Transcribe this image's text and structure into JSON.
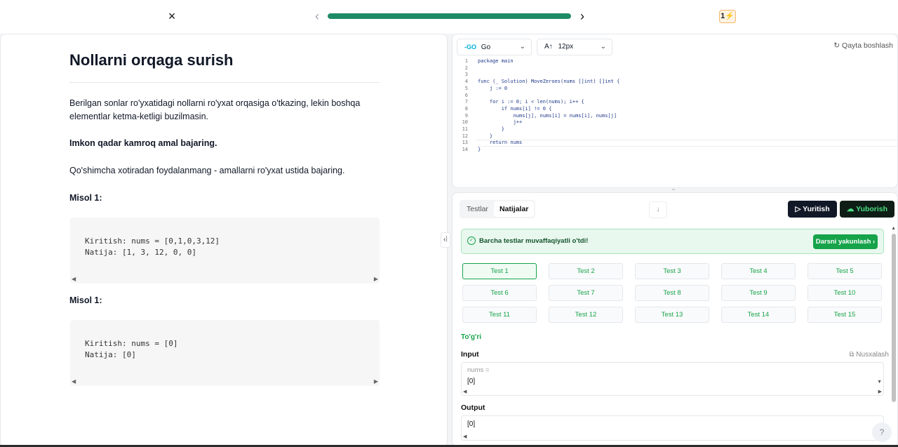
{
  "topbar": {
    "close_icon": "×",
    "prev_icon": "‹",
    "next_icon": "›",
    "progress_fraction": 1.0,
    "streak": "1⚡"
  },
  "problem": {
    "title": "Nollarni orqaga surish",
    "description": "Berilgan sonlar ro'yxatidagi nollarni ro'yxat orqasiga o'tkazing, lekin boshqa elementlar ketma-ketligi buzilmasin.",
    "note_bold": "Imkon qadar kamroq amal bajaring.",
    "note": "Qo'shimcha xotiradan foydalanmang - amallarni ro'yxat ustida bajaring.",
    "examples": [
      {
        "heading": "Misol 1:",
        "code": "Kiritish: nums = [0,1,0,3,12]\nNatija: [1, 3, 12, 0, 0]"
      },
      {
        "heading": "Misol 1:",
        "code": "Kiritish: nums = [0]\nNatija: [0]"
      }
    ]
  },
  "editor": {
    "language": "Go",
    "language_icon": "-GO",
    "font_size": "12px",
    "font_size_icon": "A↑",
    "restart_label": "Qayta boshlash",
    "restart_icon": "↻",
    "code_lines": [
      "package main",
      "",
      "",
      "func (_ Solution) MoveZeroes(nums []int) []int {",
      "    j := 0",
      "",
      "    for i := 0; i < len(nums); i++ {",
      "        if nums[i] != 0 {",
      "            nums[j], nums[i] = nums[i], nums[j]",
      "            j++",
      "        }",
      "    }",
      "    return nums",
      "}"
    ]
  },
  "results": {
    "tabs": [
      "Testlar",
      "Natijalar"
    ],
    "active_tab": "Natijalar",
    "run_label": "Yuritish",
    "submit_label": "Yuborish",
    "banner_message": "Barcha testlar muvaffaqiyatli o'tdi!",
    "finish_label": "Darsni yakunlash",
    "tests": [
      "Test 1",
      "Test 2",
      "Test 3",
      "Test 4",
      "Test 5",
      "Test 6",
      "Test 7",
      "Test 8",
      "Test 9",
      "Test 10",
      "Test 11",
      "Test 12",
      "Test 13",
      "Test 14",
      "Test 15"
    ],
    "selected_test": "Test 1",
    "status": "To'g'ri",
    "input_label": "Input",
    "copy_label": "Nusxalash",
    "input_var": "nums =",
    "input_value": "[0]",
    "output_label": "Output",
    "output_value": "[0]"
  },
  "colors": {
    "accent_green": "#16a34a",
    "progress": "#1f8a67",
    "dark_button": "#111827"
  }
}
